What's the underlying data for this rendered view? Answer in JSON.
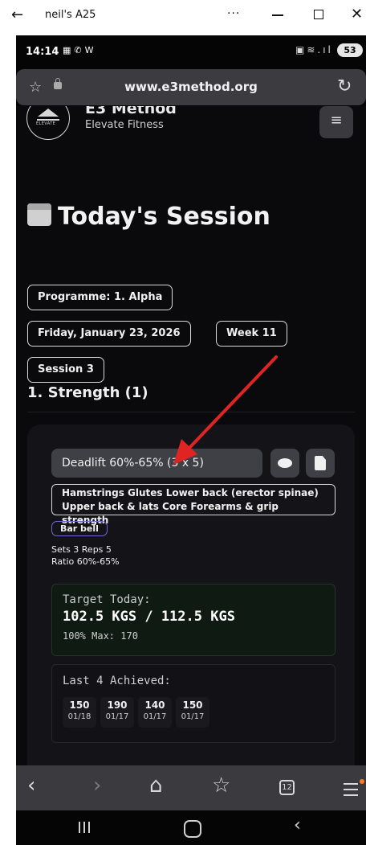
{
  "window": {
    "back_glyph": "←",
    "title": "neil's A25",
    "more_glyph": "···",
    "close_glyph": "✕"
  },
  "phone_status": {
    "time": "14:14",
    "left_icons": "▦✆W",
    "right_icons": "▣≋.ıl",
    "battery": "53"
  },
  "browser": {
    "url": "www.e3method.org",
    "star_glyph": "☆",
    "reload_glyph": "↻"
  },
  "site": {
    "brand_name": "E3 Method",
    "brand_sub": "Elevate Fitness",
    "logo_text": "ELEVATE",
    "menu_glyph": "≡"
  },
  "session": {
    "title": "Today's Session",
    "programme": "Programme: 1. Alpha",
    "date": "Friday, January 23, 2026",
    "week": "Week 11",
    "session": "Session 3"
  },
  "section": {
    "title": "1. Strength (1)"
  },
  "exercise": {
    "name": "Deadlift 60%-65% (3 x 5)",
    "muscles_line1": "Hamstrings Glutes Lower back (erector spinae)",
    "muscles_line2": "Upper back & lats Core Forearms & grip strength",
    "equipment": "Bar bell",
    "sets_reps": "Sets 3 Reps 5",
    "ratio": "Ratio 60%-65%"
  },
  "target": {
    "label": "Target Today:",
    "value": "102.5 KGS / 112.5 KGS",
    "max": "100% Max: 170"
  },
  "achieved": {
    "label": "Last 4 Achieved:",
    "items": [
      {
        "value": "150",
        "date": "01/18"
      },
      {
        "value": "190",
        "date": "01/17"
      },
      {
        "value": "140",
        "date": "01/17"
      },
      {
        "value": "150",
        "date": "01/17"
      }
    ]
  },
  "browser_nav": {
    "back_glyph": "‹",
    "forward_glyph": "›",
    "home_glyph": "⌂",
    "fav_glyph": "☆",
    "tabs_count": "12"
  },
  "system_nav": {
    "back_glyph": "‹"
  },
  "colors": {
    "page_bg": "#0a0a0c",
    "card_bg": "#141418",
    "target_bg": "#0f1a12",
    "annotation_arrow": "#e02424",
    "notification_dot": "#ff7b2b"
  }
}
